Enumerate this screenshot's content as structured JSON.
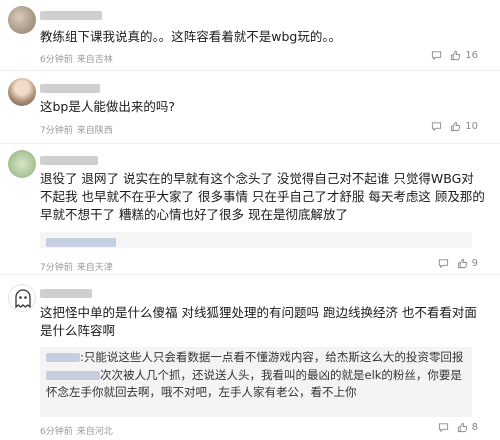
{
  "comments": [
    {
      "content": "教练组下课我说真的。。这阵容看着就不是wbg玩的。。",
      "time": "6分钟前",
      "source": "来自吉林",
      "likes": "16"
    },
    {
      "content": "这bp是人能做出来的吗?",
      "time": "7分钟前",
      "source": "来自陕西",
      "likes": "10"
    },
    {
      "content": "退役了 退网了 说实在的早就有这个念头了 没觉得自己对不起谁 只觉得WBG对不起我 也早就不在乎大家了 很多事情 只在乎自己了才舒服 每天考虑这 顾及那的 早就不想干了 糟糕的心情也好了很多 现在是彻底解放了",
      "time": "7分钟前",
      "source": "来自天津",
      "likes": "9"
    },
    {
      "content": "这把怪中单的是什么傻福 对线狐狸处理的有问题吗 跑边线换经济 也不看看对面是什么阵容啊",
      "time": "6分钟前",
      "source": "来自河北",
      "likes": "8",
      "replies": [
        ":只能说这些人只会看数据一点看不懂游戏内容，给杰斯这么大的投资零回报",
        "次次被人几个抓，还说送人头，我看叫的最凶的就是elk的粉丝，你要是怀念左手你就回去啊，哦不对吧，左手人家有老公，看不上你"
      ]
    }
  ],
  "icons": {
    "comment": "comment-icon",
    "like": "thumbs-up-icon"
  }
}
